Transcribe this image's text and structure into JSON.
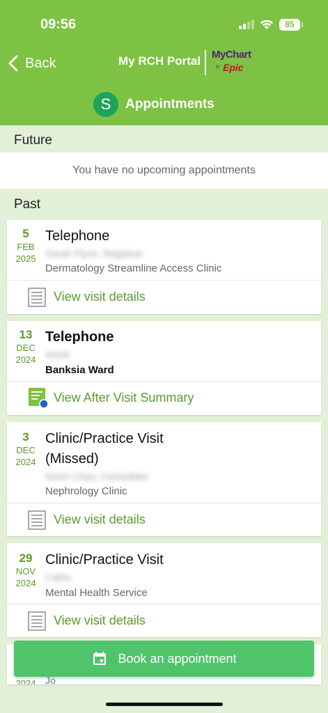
{
  "status_bar": {
    "time": "09:56",
    "battery": "85"
  },
  "header": {
    "back_label": "Back",
    "portal_name": "My RCH Portal",
    "brand_mychart": "MyChart",
    "brand_is": "is",
    "brand_epic": "Epic",
    "avatar_initial": "S",
    "page_title": "Appointments"
  },
  "future": {
    "label": "Future",
    "empty_message": "You have no upcoming appointments"
  },
  "past": {
    "label": "Past",
    "appointments": [
      {
        "day": "5",
        "month": "FEB",
        "year": "2025",
        "type": "Telephone",
        "provider": "Sarah Flynn, Registrar",
        "department": "Dermatology Streamline Access Clinic",
        "action": "View visit details"
      },
      {
        "day": "13",
        "month": "DEC",
        "year": "2024",
        "type": "Telephone",
        "provider": "Annie",
        "department": "Banksia Ward",
        "action": "View After Visit Summary"
      },
      {
        "day": "3",
        "month": "DEC",
        "year": "2024",
        "type": "Clinic/Practice Visit",
        "type_line2": "(Missed)",
        "provider": "Kevin Chau, Consultant",
        "department": "Nephrology Clinic",
        "action": "View visit details"
      },
      {
        "day": "29",
        "month": "NOV",
        "year": "2024",
        "type": "Clinic/Practice Visit",
        "provider": "Catho",
        "department": "Mental Health Service",
        "action": "View visit details"
      },
      {
        "year": "2024",
        "provider": "Jo"
      }
    ]
  },
  "book_button": {
    "label": "Book an appointment"
  },
  "colors": {
    "header_green": "#7dc242",
    "accent_green": "#5c9a2e",
    "button_green": "#4fc46b",
    "avatar_green": "#1fa35c",
    "background": "#e3f0d8"
  }
}
